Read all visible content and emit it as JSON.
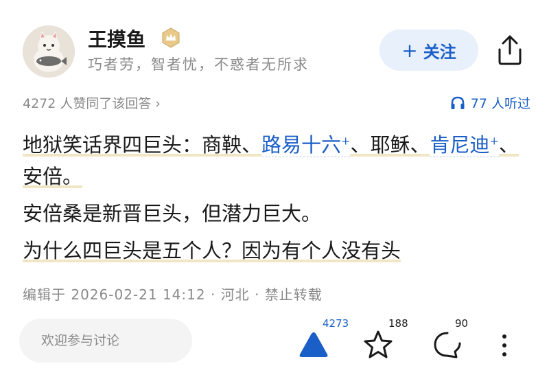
{
  "author": {
    "name": "王摸鱼",
    "bio": "巧者劳，智者忧，不惑者无所求"
  },
  "header": {
    "follow_label": "关注",
    "follow_plus": "+"
  },
  "meta": {
    "agree_text": "4272 人赞同了该回答 ›",
    "listen_text": "77 人听过"
  },
  "content": {
    "p1_a": "地狱笑话界四巨头：商鞅、",
    "p1_link1": "路易十六",
    "p1_b": "、耶稣、",
    "p1_link2": "肯尼迪",
    "p1_c": "、安倍。",
    "link_mark": "+",
    "p2": "安倍桑是新晋巨头，但潜力巨大。",
    "p3": "为什么四巨头是五个人？因为有个人没有头"
  },
  "edit_info": "编辑于 2026-02-21 14:12 · 河北 · 禁止转载",
  "bottom": {
    "comment_placeholder": "欢迎参与讨论",
    "upvote_count": "4273",
    "favorite_count": "188",
    "comment_count": "90"
  },
  "colors": {
    "accent": "#1a5ec7",
    "follow_bg": "#e8f0fc",
    "muted": "#8a8a8a"
  },
  "icons": [
    "verified-crown-icon",
    "share-icon",
    "headphones-icon",
    "upvote-triangle-icon",
    "star-icon",
    "comment-icon",
    "more-vertical-icon"
  ]
}
